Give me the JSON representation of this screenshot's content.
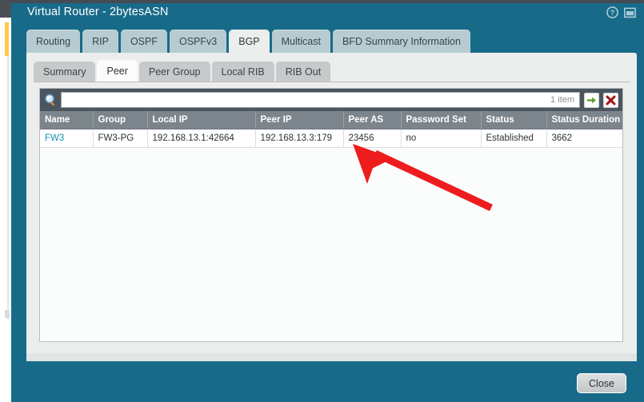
{
  "window": {
    "title": "Virtual Router - 2bytesASN",
    "help_icon": "help-circle-icon",
    "restore_icon": "restore-window-icon",
    "accent_color": "#176b89"
  },
  "main_tabs": [
    {
      "label": "Routing",
      "active": false
    },
    {
      "label": "RIP",
      "active": false
    },
    {
      "label": "OSPF",
      "active": false
    },
    {
      "label": "OSPFv3",
      "active": false
    },
    {
      "label": "BGP",
      "active": true
    },
    {
      "label": "Multicast",
      "active": false
    },
    {
      "label": "BFD Summary Information",
      "active": false
    }
  ],
  "sub_tabs": [
    {
      "label": "Summary",
      "active": false
    },
    {
      "label": "Peer",
      "active": true
    },
    {
      "label": "Peer Group",
      "active": false
    },
    {
      "label": "Local RIB",
      "active": false
    },
    {
      "label": "RIB Out",
      "active": false
    }
  ],
  "search": {
    "value": "",
    "placeholder": "",
    "item_count": "1 item",
    "search_icon": "magnifier-icon",
    "apply_icon": "green-arrow-icon",
    "clear_icon": "red-x-icon"
  },
  "table": {
    "columns": [
      "Name",
      "Group",
      "Local IP",
      "Peer IP",
      "Peer AS",
      "Password Set",
      "Status",
      "Status Duration (secs.)"
    ],
    "rows": [
      {
        "name": "FW3",
        "group": "FW3-PG",
        "local_ip": "192.168.13.1:42664",
        "peer_ip": "192.168.13.3:179",
        "peer_as": "23456",
        "password_set": "no",
        "status": "Established",
        "status_duration": "3662"
      }
    ]
  },
  "footer": {
    "close_label": "Close"
  },
  "annotation": {
    "arrow_color": "#ee1c1c",
    "points_at": "23456"
  }
}
